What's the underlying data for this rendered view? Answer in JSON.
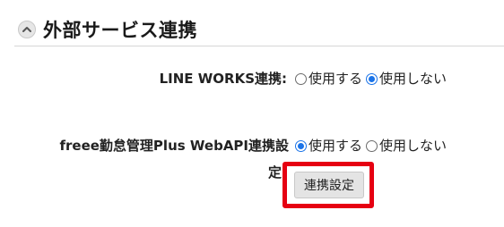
{
  "section": {
    "title": "外部サービス連携"
  },
  "rows": [
    {
      "label": "LINE WORKS連携:",
      "options": [
        "使用する",
        "使用しない"
      ],
      "selected": "使用しない"
    },
    {
      "label_line1": "freee勤怠管理Plus WebAPI連携設",
      "label_line2": "定:",
      "options": [
        "使用する",
        "使用しない"
      ],
      "selected": "使用する",
      "button_label": "連携設定"
    }
  ],
  "colors": {
    "highlight": "#e60012",
    "radio_selected": "#1a73e8"
  }
}
